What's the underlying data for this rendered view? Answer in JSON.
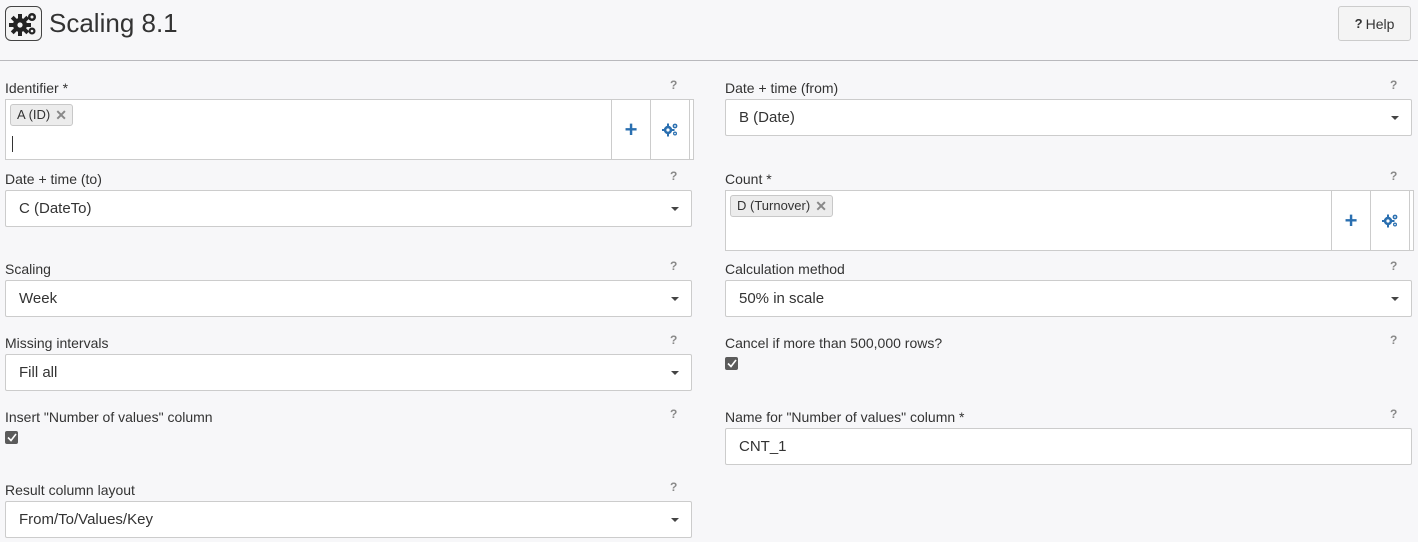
{
  "header": {
    "title": "Scaling 8.1",
    "help_icon": "?",
    "help_label": "Help"
  },
  "fields": {
    "identifier": {
      "label": "Identifier *",
      "tags": [
        "A (ID)"
      ],
      "remove_glyph": "✕",
      "add_glyph": "+",
      "help": "?"
    },
    "date_from": {
      "label": "Date + time (from)",
      "value": "B (Date)",
      "help": "?"
    },
    "date_to": {
      "label": "Date + time (to)",
      "value": "C (DateTo)",
      "help": "?"
    },
    "count": {
      "label": "Count *",
      "tags": [
        "D (Turnover)"
      ],
      "remove_glyph": "✕",
      "add_glyph": "+",
      "help": "?"
    },
    "scaling": {
      "label": "Scaling",
      "value": "Week",
      "help": "?"
    },
    "calc_method": {
      "label": "Calculation method",
      "value": "50% in scale",
      "help": "?"
    },
    "missing_intervals": {
      "label": "Missing intervals",
      "value": "Fill all",
      "help": "?"
    },
    "cancel_rows": {
      "label": "Cancel if more than 500,000 rows?",
      "checked": true,
      "help": "?"
    },
    "insert_count_col": {
      "label": "Insert \"Number of values\" column",
      "checked": true,
      "help": "?"
    },
    "count_col_name": {
      "label": "Name for \"Number of values\" column *",
      "value": "CNT_1",
      "help": "?"
    },
    "result_layout": {
      "label": "Result column layout",
      "value": "From/To/Values/Key",
      "help": "?"
    }
  }
}
